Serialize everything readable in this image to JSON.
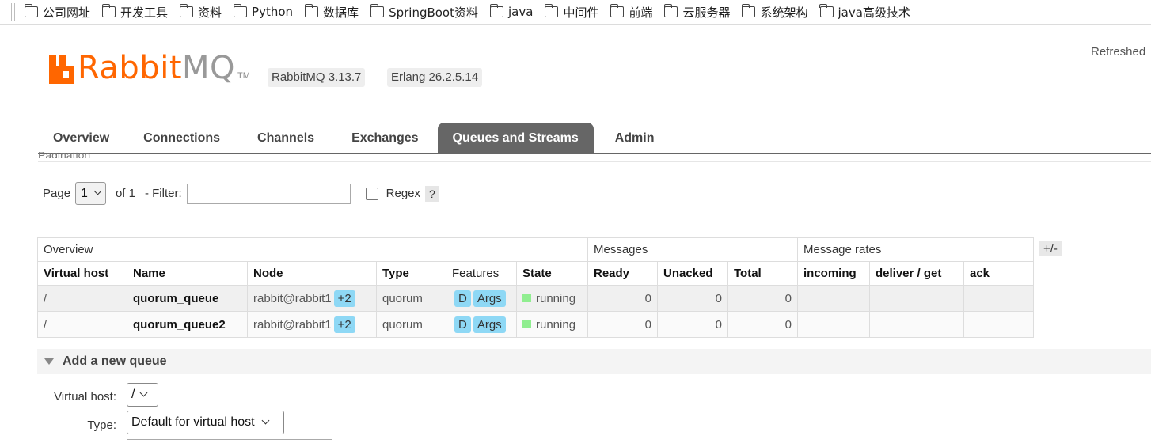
{
  "bookmarks": [
    "公司网址",
    "开发工具",
    "资料",
    "Python",
    "数据库",
    "SpringBoot资料",
    "java",
    "中间件",
    "前端",
    "云服务器",
    "系统架构",
    "java高级技术"
  ],
  "header": {
    "logo_rabbit": "Rabbit",
    "logo_mq": "MQ",
    "logo_tm": "TM",
    "rabbitmq_version": "RabbitMQ 3.13.7",
    "erlang_version": "Erlang 26.2.5.14",
    "refreshed": "Refreshed"
  },
  "tabs": [
    "Overview",
    "Connections",
    "Channels",
    "Exchanges",
    "Queues and Streams",
    "Admin"
  ],
  "active_tab": "Queues and Streams",
  "pagination": {
    "section_label": "Pagination",
    "page_label": "Page",
    "page_value": "1",
    "of_label": "of 1",
    "filter_label": "- Filter:",
    "filter_value": "",
    "regex_label": "Regex",
    "help": "?"
  },
  "table": {
    "groups": [
      "Overview",
      "Messages",
      "Message rates"
    ],
    "toggle_columns": "+/-",
    "columns": [
      "Virtual host",
      "Name",
      "Node",
      "Type",
      "Features",
      "State",
      "Ready",
      "Unacked",
      "Total",
      "incoming",
      "deliver / get",
      "ack"
    ],
    "rows": [
      {
        "vhost": "/",
        "name": "quorum_queue",
        "node": "rabbit@rabbit1",
        "node_extra": "+2",
        "type": "quorum",
        "feature_d": "D",
        "feature_args": "Args",
        "state": "running",
        "ready": "0",
        "unacked": "0",
        "total": "0",
        "incoming": "",
        "deliver_get": "",
        "ack": ""
      },
      {
        "vhost": "/",
        "name": "quorum_queue2",
        "node": "rabbit@rabbit1",
        "node_extra": "+2",
        "type": "quorum",
        "feature_d": "D",
        "feature_args": "Args",
        "state": "running",
        "ready": "0",
        "unacked": "0",
        "total": "0",
        "incoming": "",
        "deliver_get": "",
        "ack": ""
      }
    ]
  },
  "add_queue": {
    "title": "Add a new queue",
    "vhost_label": "Virtual host:",
    "vhost_value": "/",
    "type_label": "Type:",
    "type_value": "Default for virtual host"
  },
  "colors": {
    "brand_orange": "#ff6600",
    "tab_active": "#666666",
    "badge_blue": "#8ed8f5",
    "running_green": "#90ee90"
  }
}
